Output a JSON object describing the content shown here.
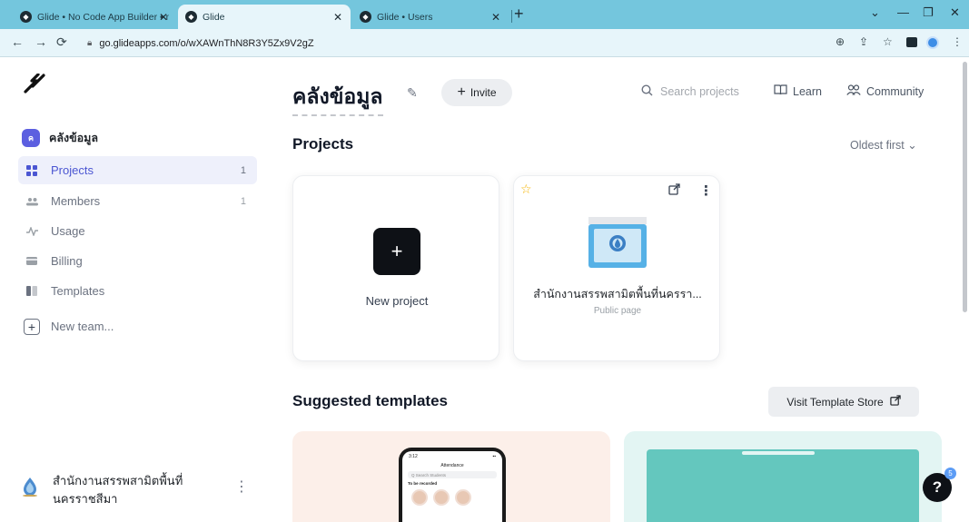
{
  "browser": {
    "tabs": [
      {
        "label": "Glide • No Code App Builder • n",
        "active": false
      },
      {
        "label": "Glide",
        "active": true
      },
      {
        "label": "Glide • Users",
        "active": false
      }
    ],
    "url": "go.glideapps.com/o/wXAWnThN8R3Y5Zx9V2gZ",
    "colors": {
      "tabbar": "#74c6dd",
      "toolbar": "#e7f5fa"
    }
  },
  "sidebar": {
    "team_initial": "ค",
    "team_name": "คลังข้อมูล",
    "items": [
      {
        "label": "Projects",
        "count": "1",
        "icon": "grid-icon"
      },
      {
        "label": "Members",
        "count": "1",
        "icon": "members-icon"
      },
      {
        "label": "Usage",
        "count": "",
        "icon": "pulse-icon"
      },
      {
        "label": "Billing",
        "count": "",
        "icon": "card-icon"
      },
      {
        "label": "Templates",
        "count": "",
        "icon": "templates-icon"
      }
    ],
    "new_team": "New team...",
    "org_name": "สำนักงานสรรพสามิตพื้นที่นครราชสีมา"
  },
  "header": {
    "title": "คลังข้อมูล",
    "invite": "Invite",
    "search_placeholder": "Search projects",
    "learn": "Learn",
    "community": "Community"
  },
  "projects": {
    "heading": "Projects",
    "sort": "Oldest first",
    "new_project": "New project",
    "items": [
      {
        "name": "สำนักงานสรรพสามิตพื้นที่นครรา...",
        "visibility": "Public page",
        "starred": true
      }
    ]
  },
  "templates": {
    "heading": "Suggested templates",
    "store_button": "Visit Template Store",
    "phone": {
      "time": "3:12",
      "title": "Attendance",
      "search": "Q Search Students",
      "section": "To be recorded"
    }
  },
  "help": {
    "label": "?",
    "badge": "5"
  },
  "accent": "#4b56d2"
}
